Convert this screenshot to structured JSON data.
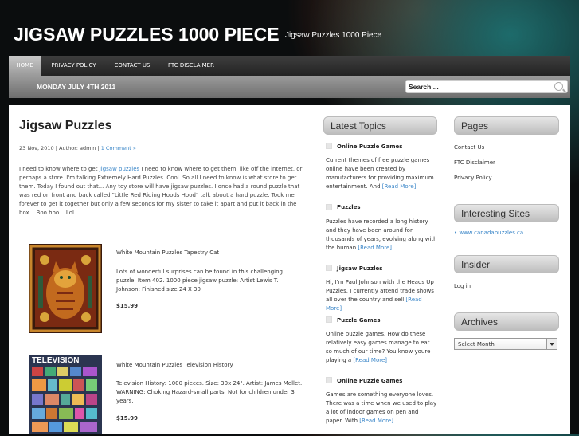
{
  "site": {
    "title": "JIGSAW PUZZLES 1000 PIECE",
    "description": "Jigsaw Puzzles 1000 Piece"
  },
  "nav": {
    "items": [
      "HOME",
      "PRIVACY POLICY",
      "CONTACT US",
      "FTC DISCLAIMER"
    ]
  },
  "datebar": {
    "date": "MONDAY JULY 4TH 2011",
    "search_placeholder": "Search ..."
  },
  "post": {
    "title": "Jigsaw Puzzles",
    "meta_prefix": "23 Nov, 2010 | Author: admin | ",
    "comments": "1 Comment »",
    "body_pre": "I need to know where to get ",
    "body_link": "Jigsaw puzzles",
    "body_post": " I need to know where to get them, like off the internet, or perhaps a store. I'm talking Extremely Hard Puzzles. Cool. So all I need to know is what store to get them. Today I found out that... Any toy store will have jigsaw puzzles. I once had a round puzzle that was red on front and back called \"Little Red Riding Hoods Hood\" talk about a hard puzzle. Took me forever to get it together but only a few seconds for my sister to take it apart and put it back in the box. . Boo hoo. . Lol"
  },
  "products": [
    {
      "title": "White Mountain Puzzles Tapestry Cat",
      "desc": "Lots of wonderful surprises can be found in this challenging puzzle. Item 402. 1000 piece jigsaw puzzle: Artist Lewis T. Johnson: Finished size 24 X 30",
      "price": "$15.99"
    },
    {
      "title": "White Mountain Puzzles Television History",
      "desc": "Television History: 1000 pieces. Size: 30x 24\". Artist: James Mellet. WARNING: Choking Hazard-small parts. Not for children under 3 years.",
      "price": "$15.99",
      "image_text": "TELEVISION"
    }
  ],
  "latest": {
    "heading": "Latest Topics",
    "items": [
      {
        "title": "Online Puzzle Games",
        "text": "Current themes of free puzzle games online have been created by manufacturers for providing maximum entertainment. And ",
        "more": "[Read More]"
      },
      {
        "title": "Puzzles",
        "text": "Puzzles have recorded a long history and they have been around for thousands of years, evolving along with the human ",
        "more": "[Read More]"
      },
      {
        "title": "Jigsaw Puzzles",
        "text": "Hi, I'm Paul Johnson with the Heads Up Puzzles. I currently attend trade shows all over the country and sell ",
        "more": "[Read More]"
      },
      {
        "title": "Puzzle Games",
        "text": "Online puzzle games. How do these relatively easy games manage to eat so much of our time? You know youre playing a ",
        "more": "[Read More]"
      },
      {
        "title": "Online Puzzle Games",
        "text": "Games are something everyone loves. There was a time when we used to play a lot of indoor games on pen and paper. With ",
        "more": "[Read More]"
      }
    ]
  },
  "sidebar": {
    "pages_heading": "Pages",
    "pages": [
      "Contact Us",
      "FTC Disclaimer",
      "Privacy Policy"
    ],
    "sites_heading": "Interesting Sites",
    "sites": [
      "• www.canadapuzzles.ca"
    ],
    "insider_heading": "Insider",
    "insider_link": "Log in",
    "archives_heading": "Archives",
    "archives_select": "Select Month"
  }
}
